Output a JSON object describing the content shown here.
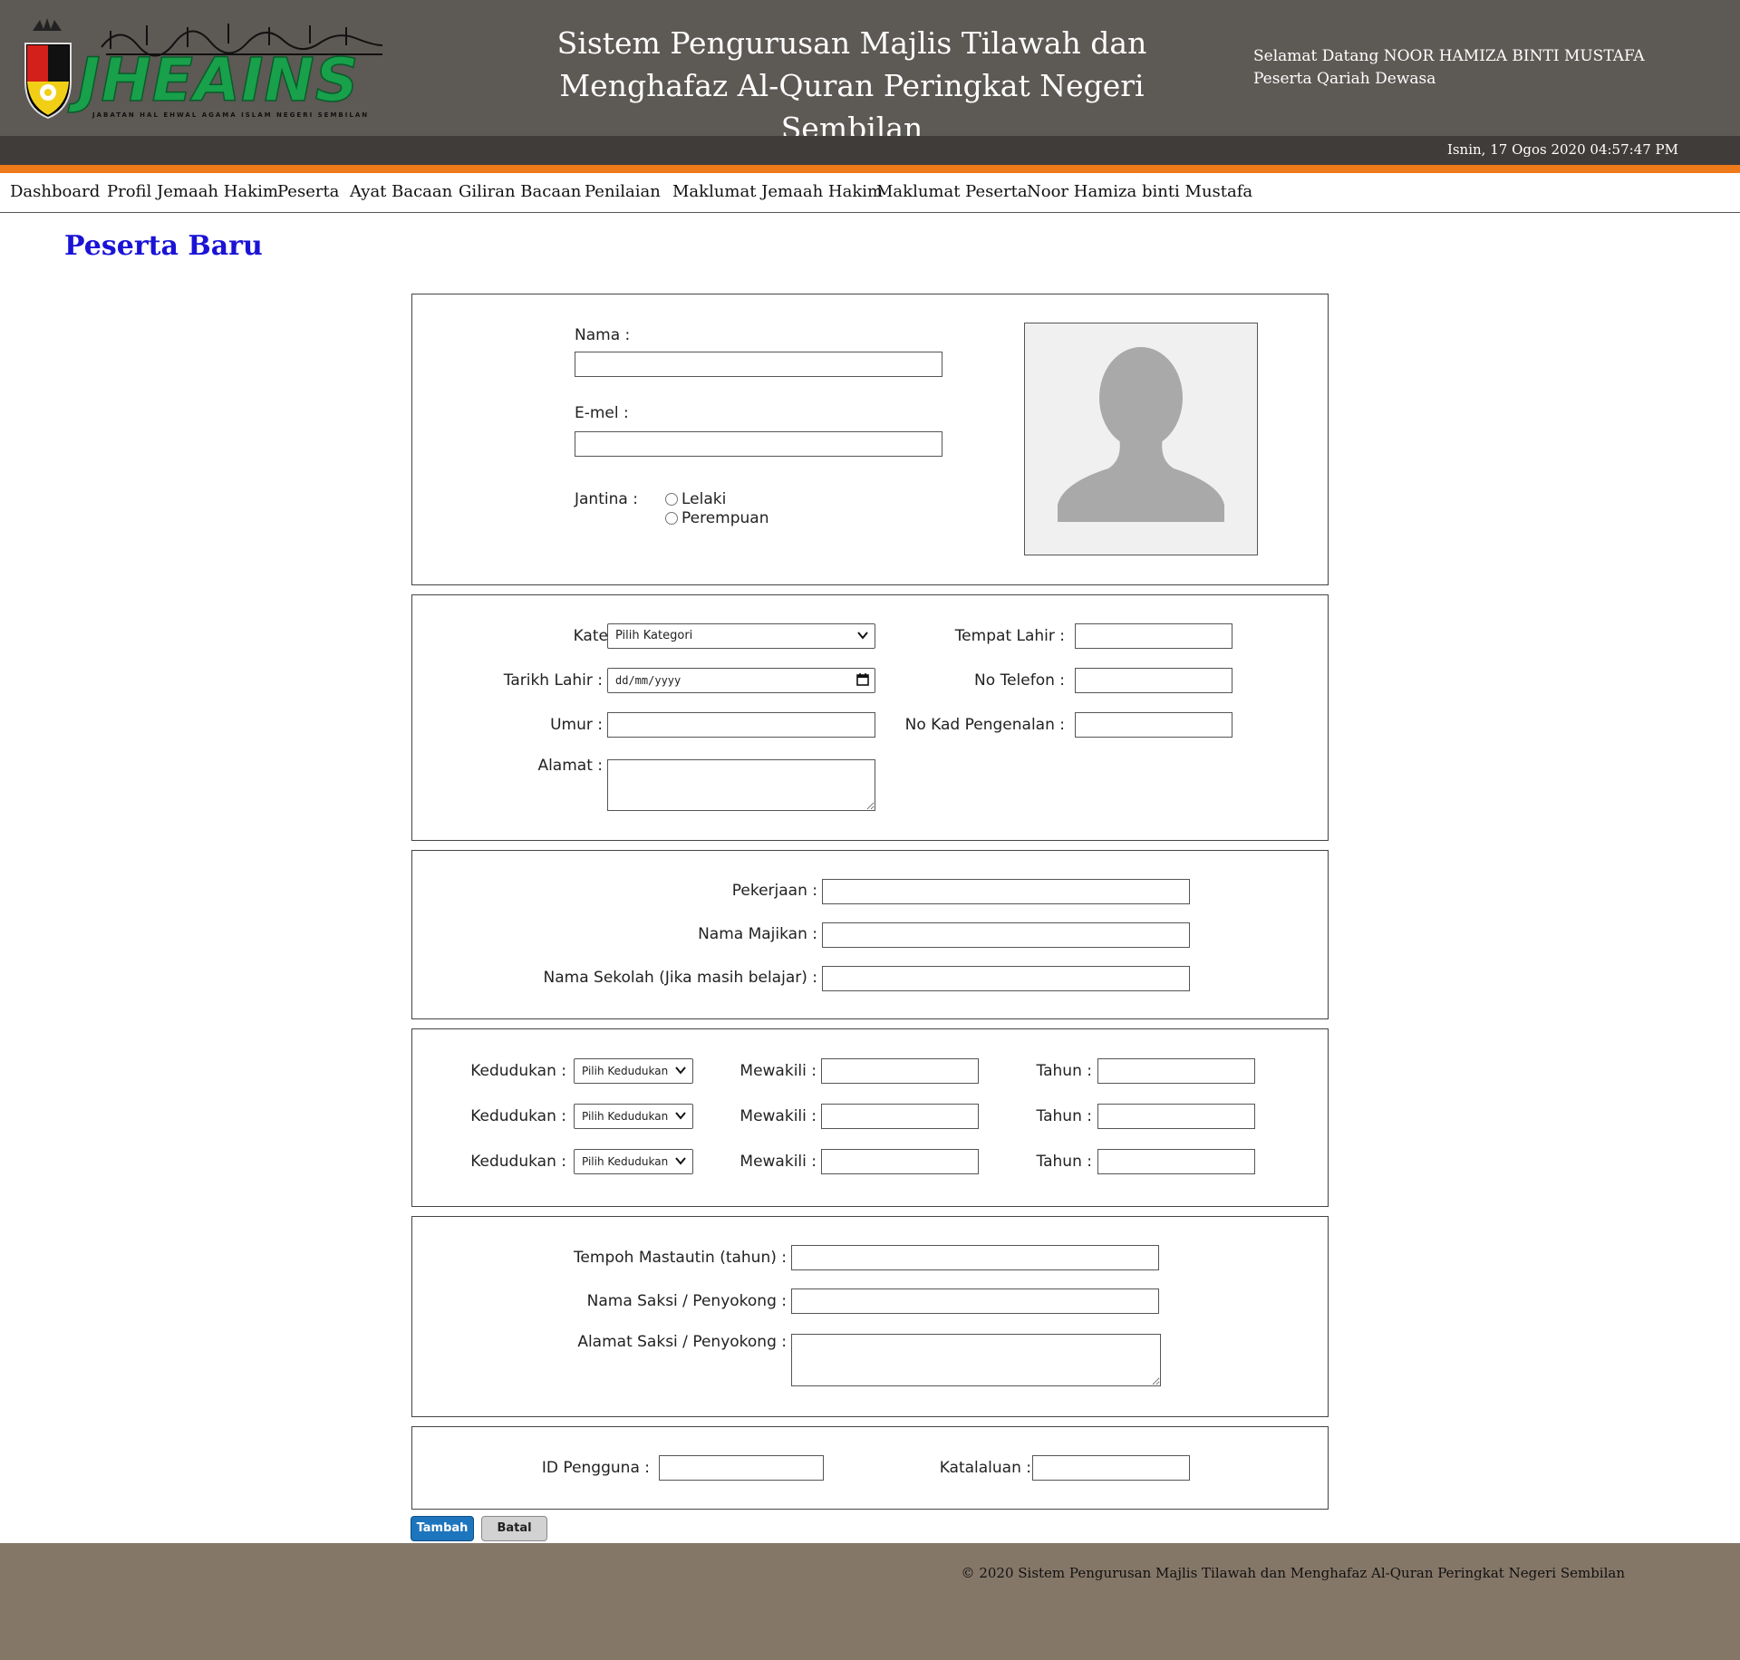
{
  "header": {
    "title_line1": "Sistem Pengurusan Majlis Tilawah dan",
    "title_line2": "Menghafaz Al-Quran Peringkat Negeri Sembilan",
    "welcome": "Selamat Datang NOOR HAMIZA BINTI MUSTAFA",
    "user_role": "Peserta Qariah Dewasa",
    "datetime": "Isnin, 17 Ogos 2020 04:57:47 PM",
    "logo_text": "JHEAINS",
    "logo_subtext": "JABATAN HAL EHWAL AGAMA ISLAM NEGERI SEMBILAN"
  },
  "colors": {
    "header_bg": "#5d5955",
    "subbar_bg": "#403c39",
    "accent_orange": "#ef7a1a",
    "logo_green": "#18a04b",
    "title_blue": "#1a13d6",
    "button_primary": "#1d75bd",
    "footer_bg": "#857768"
  },
  "nav": {
    "items": [
      {
        "label": "Dashboard"
      },
      {
        "label": "Profil Jemaah Hakim"
      },
      {
        "label": "Peserta"
      },
      {
        "label": "Ayat Bacaan"
      },
      {
        "label": "Giliran Bacaan"
      },
      {
        "label": "Penilaian"
      },
      {
        "label": "Maklumat Jemaah Hakim"
      },
      {
        "label": "Maklumat Peserta"
      },
      {
        "label": "Noor Hamiza binti Mustafa"
      }
    ]
  },
  "page": {
    "title": "Peserta Baru"
  },
  "form": {
    "section1": {
      "nama_label": "Nama :",
      "email_label": "E-mel :",
      "jantina_label": "Jantina :",
      "gender_options": [
        "Lelaki",
        "Perempuan"
      ],
      "photo_icon": "user-silhouette-icon"
    },
    "section2": {
      "kategori_label": "Kategori :",
      "kategori_value": "Pilih Kategori",
      "tarikh_lahir_label": "Tarikh Lahir :",
      "tarikh_lahir_placeholder": "dd/mm/yyyy",
      "umur_label": "Umur :",
      "alamat_label": "Alamat :",
      "tempat_lahir_label": "Tempat Lahir :",
      "no_telefon_label": "No Telefon :",
      "no_kad_label": "No Kad Pengenalan :"
    },
    "section3": {
      "pekerjaan_label": "Pekerjaan :",
      "nama_majikan_label": "Nama Majikan :",
      "nama_sekolah_label": "Nama Sekolah (Jika masih belajar) :"
    },
    "section4": {
      "rows": [
        {
          "kedudukan_label": "Kedudukan :",
          "kedudukan_value": "Pilih Kedudukan",
          "mewakili_label": "Mewakili :",
          "tahun_label": "Tahun :"
        },
        {
          "kedudukan_label": "Kedudukan :",
          "kedudukan_value": "Pilih Kedudukan",
          "mewakili_label": "Mewakili :",
          "tahun_label": "Tahun :"
        },
        {
          "kedudukan_label": "Kedudukan :",
          "kedudukan_value": "Pilih Kedudukan",
          "mewakili_label": "Mewakili :",
          "tahun_label": "Tahun :"
        }
      ]
    },
    "section5": {
      "tempoh_label": "Tempoh Mastautin (tahun) :",
      "nama_saksi_label": "Nama Saksi / Penyokong :",
      "alamat_saksi_label": "Alamat Saksi / Penyokong :"
    },
    "section6": {
      "id_pengguna_label": "ID Pengguna :",
      "katalaluan_label": "Katalaluan :"
    },
    "buttons": {
      "add": "Tambah",
      "cancel": "Batal"
    }
  },
  "footer": {
    "copyright": "© 2020 Sistem Pengurusan Majlis Tilawah dan Menghafaz Al-Quran Peringkat Negeri Sembilan"
  }
}
